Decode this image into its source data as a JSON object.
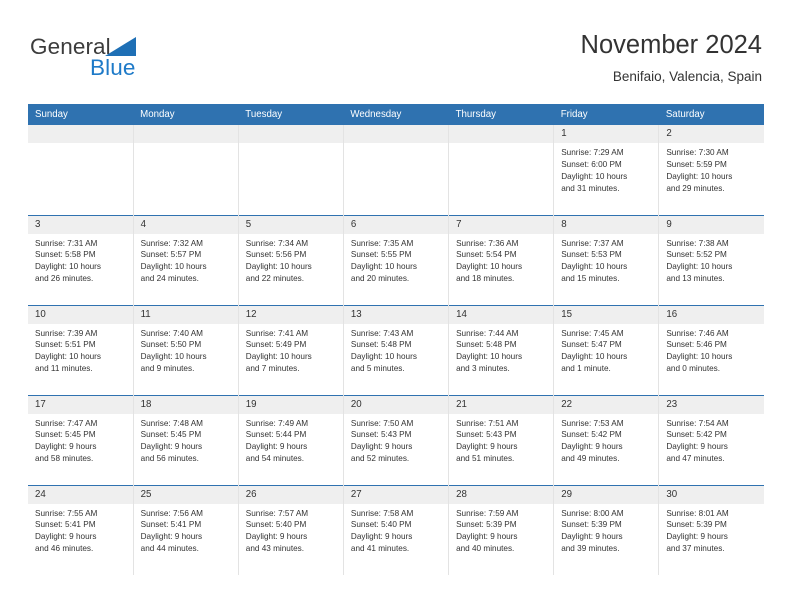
{
  "brand": {
    "name_top": "General",
    "name_bottom": "Blue",
    "triangle_color": "#1e6fb5",
    "blue_color": "#1e7ac8"
  },
  "header": {
    "title": "November 2024",
    "subtitle": "Benifaio, Valencia, Spain"
  },
  "theme": {
    "header_blue": "#2f72b0",
    "daynum_band": "#efefef",
    "text": "#333333",
    "grid_line": "#e3e3e3"
  },
  "weekday_headers": [
    "Sunday",
    "Monday",
    "Tuesday",
    "Wednesday",
    "Thursday",
    "Friday",
    "Saturday"
  ],
  "weeks": [
    [
      {
        "day": "",
        "empty": true
      },
      {
        "day": "",
        "empty": true
      },
      {
        "day": "",
        "empty": true
      },
      {
        "day": "",
        "empty": true
      },
      {
        "day": "",
        "empty": true
      },
      {
        "day": "1",
        "sunrise": "Sunrise: 7:29 AM",
        "sunset": "Sunset: 6:00 PM",
        "daylight_line1": "Daylight: 10 hours",
        "daylight_line2": "and 31 minutes."
      },
      {
        "day": "2",
        "sunrise": "Sunrise: 7:30 AM",
        "sunset": "Sunset: 5:59 PM",
        "daylight_line1": "Daylight: 10 hours",
        "daylight_line2": "and 29 minutes."
      }
    ],
    [
      {
        "day": "3",
        "sunrise": "Sunrise: 7:31 AM",
        "sunset": "Sunset: 5:58 PM",
        "daylight_line1": "Daylight: 10 hours",
        "daylight_line2": "and 26 minutes."
      },
      {
        "day": "4",
        "sunrise": "Sunrise: 7:32 AM",
        "sunset": "Sunset: 5:57 PM",
        "daylight_line1": "Daylight: 10 hours",
        "daylight_line2": "and 24 minutes."
      },
      {
        "day": "5",
        "sunrise": "Sunrise: 7:34 AM",
        "sunset": "Sunset: 5:56 PM",
        "daylight_line1": "Daylight: 10 hours",
        "daylight_line2": "and 22 minutes."
      },
      {
        "day": "6",
        "sunrise": "Sunrise: 7:35 AM",
        "sunset": "Sunset: 5:55 PM",
        "daylight_line1": "Daylight: 10 hours",
        "daylight_line2": "and 20 minutes."
      },
      {
        "day": "7",
        "sunrise": "Sunrise: 7:36 AM",
        "sunset": "Sunset: 5:54 PM",
        "daylight_line1": "Daylight: 10 hours",
        "daylight_line2": "and 18 minutes."
      },
      {
        "day": "8",
        "sunrise": "Sunrise: 7:37 AM",
        "sunset": "Sunset: 5:53 PM",
        "daylight_line1": "Daylight: 10 hours",
        "daylight_line2": "and 15 minutes."
      },
      {
        "day": "9",
        "sunrise": "Sunrise: 7:38 AM",
        "sunset": "Sunset: 5:52 PM",
        "daylight_line1": "Daylight: 10 hours",
        "daylight_line2": "and 13 minutes."
      }
    ],
    [
      {
        "day": "10",
        "sunrise": "Sunrise: 7:39 AM",
        "sunset": "Sunset: 5:51 PM",
        "daylight_line1": "Daylight: 10 hours",
        "daylight_line2": "and 11 minutes."
      },
      {
        "day": "11",
        "sunrise": "Sunrise: 7:40 AM",
        "sunset": "Sunset: 5:50 PM",
        "daylight_line1": "Daylight: 10 hours",
        "daylight_line2": "and 9 minutes."
      },
      {
        "day": "12",
        "sunrise": "Sunrise: 7:41 AM",
        "sunset": "Sunset: 5:49 PM",
        "daylight_line1": "Daylight: 10 hours",
        "daylight_line2": "and 7 minutes."
      },
      {
        "day": "13",
        "sunrise": "Sunrise: 7:43 AM",
        "sunset": "Sunset: 5:48 PM",
        "daylight_line1": "Daylight: 10 hours",
        "daylight_line2": "and 5 minutes."
      },
      {
        "day": "14",
        "sunrise": "Sunrise: 7:44 AM",
        "sunset": "Sunset: 5:48 PM",
        "daylight_line1": "Daylight: 10 hours",
        "daylight_line2": "and 3 minutes."
      },
      {
        "day": "15",
        "sunrise": "Sunrise: 7:45 AM",
        "sunset": "Sunset: 5:47 PM",
        "daylight_line1": "Daylight: 10 hours",
        "daylight_line2": "and 1 minute."
      },
      {
        "day": "16",
        "sunrise": "Sunrise: 7:46 AM",
        "sunset": "Sunset: 5:46 PM",
        "daylight_line1": "Daylight: 10 hours",
        "daylight_line2": "and 0 minutes."
      }
    ],
    [
      {
        "day": "17",
        "sunrise": "Sunrise: 7:47 AM",
        "sunset": "Sunset: 5:45 PM",
        "daylight_line1": "Daylight: 9 hours",
        "daylight_line2": "and 58 minutes."
      },
      {
        "day": "18",
        "sunrise": "Sunrise: 7:48 AM",
        "sunset": "Sunset: 5:45 PM",
        "daylight_line1": "Daylight: 9 hours",
        "daylight_line2": "and 56 minutes."
      },
      {
        "day": "19",
        "sunrise": "Sunrise: 7:49 AM",
        "sunset": "Sunset: 5:44 PM",
        "daylight_line1": "Daylight: 9 hours",
        "daylight_line2": "and 54 minutes."
      },
      {
        "day": "20",
        "sunrise": "Sunrise: 7:50 AM",
        "sunset": "Sunset: 5:43 PM",
        "daylight_line1": "Daylight: 9 hours",
        "daylight_line2": "and 52 minutes."
      },
      {
        "day": "21",
        "sunrise": "Sunrise: 7:51 AM",
        "sunset": "Sunset: 5:43 PM",
        "daylight_line1": "Daylight: 9 hours",
        "daylight_line2": "and 51 minutes."
      },
      {
        "day": "22",
        "sunrise": "Sunrise: 7:53 AM",
        "sunset": "Sunset: 5:42 PM",
        "daylight_line1": "Daylight: 9 hours",
        "daylight_line2": "and 49 minutes."
      },
      {
        "day": "23",
        "sunrise": "Sunrise: 7:54 AM",
        "sunset": "Sunset: 5:42 PM",
        "daylight_line1": "Daylight: 9 hours",
        "daylight_line2": "and 47 minutes."
      }
    ],
    [
      {
        "day": "24",
        "sunrise": "Sunrise: 7:55 AM",
        "sunset": "Sunset: 5:41 PM",
        "daylight_line1": "Daylight: 9 hours",
        "daylight_line2": "and 46 minutes."
      },
      {
        "day": "25",
        "sunrise": "Sunrise: 7:56 AM",
        "sunset": "Sunset: 5:41 PM",
        "daylight_line1": "Daylight: 9 hours",
        "daylight_line2": "and 44 minutes."
      },
      {
        "day": "26",
        "sunrise": "Sunrise: 7:57 AM",
        "sunset": "Sunset: 5:40 PM",
        "daylight_line1": "Daylight: 9 hours",
        "daylight_line2": "and 43 minutes."
      },
      {
        "day": "27",
        "sunrise": "Sunrise: 7:58 AM",
        "sunset": "Sunset: 5:40 PM",
        "daylight_line1": "Daylight: 9 hours",
        "daylight_line2": "and 41 minutes."
      },
      {
        "day": "28",
        "sunrise": "Sunrise: 7:59 AM",
        "sunset": "Sunset: 5:39 PM",
        "daylight_line1": "Daylight: 9 hours",
        "daylight_line2": "and 40 minutes."
      },
      {
        "day": "29",
        "sunrise": "Sunrise: 8:00 AM",
        "sunset": "Sunset: 5:39 PM",
        "daylight_line1": "Daylight: 9 hours",
        "daylight_line2": "and 39 minutes."
      },
      {
        "day": "30",
        "sunrise": "Sunrise: 8:01 AM",
        "sunset": "Sunset: 5:39 PM",
        "daylight_line1": "Daylight: 9 hours",
        "daylight_line2": "and 37 minutes."
      }
    ]
  ]
}
